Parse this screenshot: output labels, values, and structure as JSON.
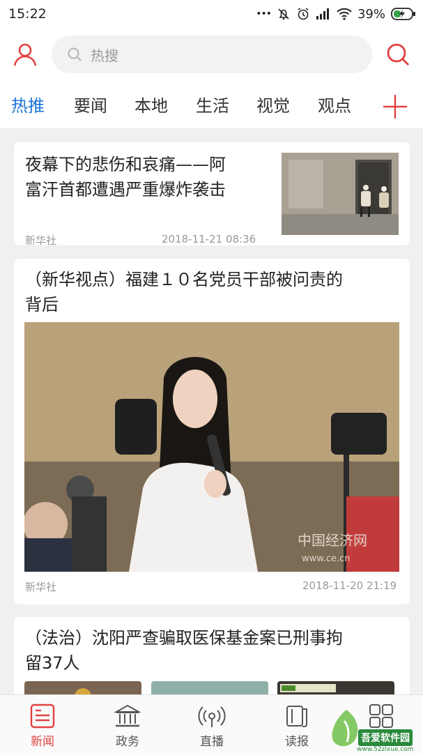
{
  "status": {
    "time": "15:22",
    "dots": "•••",
    "battery": "39%"
  },
  "header": {
    "search_placeholder": "热搜"
  },
  "tabs": [
    {
      "label": "热推",
      "active": true
    },
    {
      "label": "要闻"
    },
    {
      "label": "本地"
    },
    {
      "label": "生活"
    },
    {
      "label": "视觉"
    },
    {
      "label": "观点"
    }
  ],
  "feed": [
    {
      "title": "夜幕下的悲伤和哀痛——阿富汗首都遭遇严重爆炸袭击",
      "title_line1": "夜幕下的悲伤和哀痛——阿",
      "title_line2": "富汗首都遭遇严重爆炸袭击",
      "source": "新华社",
      "time": "2018-11-21 08:36"
    },
    {
      "title_line1": "（新华视点）福建１０名党员干部被问责的",
      "title_line2": "背后",
      "source": "新华社",
      "time": "2018-11-20 21:19",
      "watermark_line1": "中国经济网",
      "watermark_line2": "www.ce.cn"
    },
    {
      "title_line1": "（法治）沈阳严查骗取医保基金案已刑事拘",
      "title_line2": "留37人"
    }
  ],
  "tabbar": [
    {
      "label": "新闻",
      "active": true,
      "icon": "news-icon"
    },
    {
      "label": "政务",
      "icon": "government-icon"
    },
    {
      "label": "直播",
      "icon": "live-icon"
    },
    {
      "label": "读报",
      "icon": "newspaper-icon"
    },
    {
      "label": "",
      "icon": "grid-icon"
    }
  ],
  "watermark": {
    "text": "吾爱软件园",
    "url": "www.52zixue.com"
  },
  "colors": {
    "accent_red": "#e24040",
    "active_tab_blue": "#1a73d8"
  }
}
